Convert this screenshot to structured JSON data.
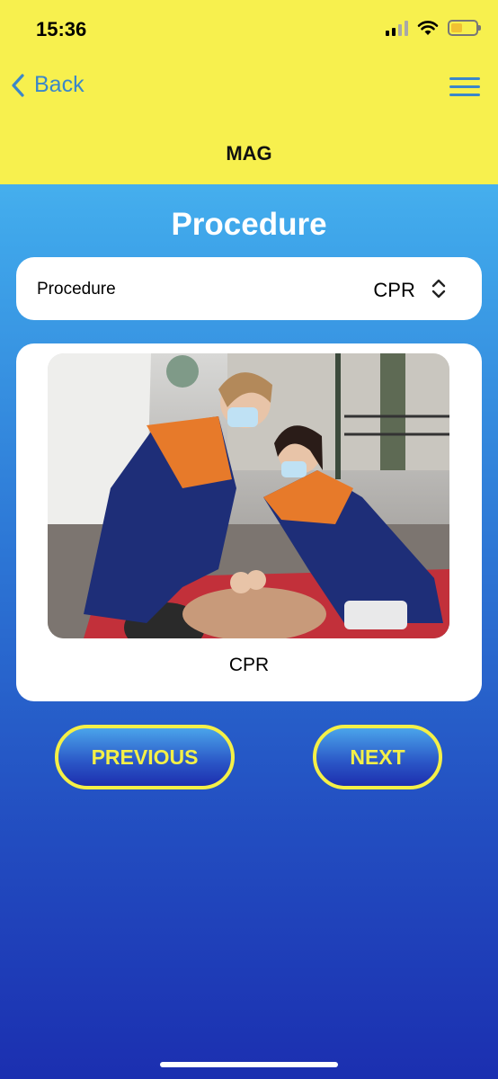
{
  "status": {
    "time": "15:36",
    "battery_level": 0.45,
    "battery_color": "#f1c232",
    "signal_bars": 4,
    "signal_active": 2,
    "wifi": "wifi-icon"
  },
  "nav": {
    "back_label": "Back",
    "menu_icon": "hamburger-menu-icon",
    "title": "MAG"
  },
  "page": {
    "section_title": "Procedure"
  },
  "selector": {
    "label": "Procedure",
    "selected": "CPR",
    "icon": "up-down-chevron-icon"
  },
  "image_card": {
    "image_subject": "cpr-training-photo",
    "caption": "CPR"
  },
  "buttons": {
    "previous": "PREVIOUS",
    "next": "NEXT"
  },
  "colors": {
    "header_bg": "#f7f04e",
    "accent_blue": "#3b87c9",
    "button_text": "#f4f047"
  }
}
